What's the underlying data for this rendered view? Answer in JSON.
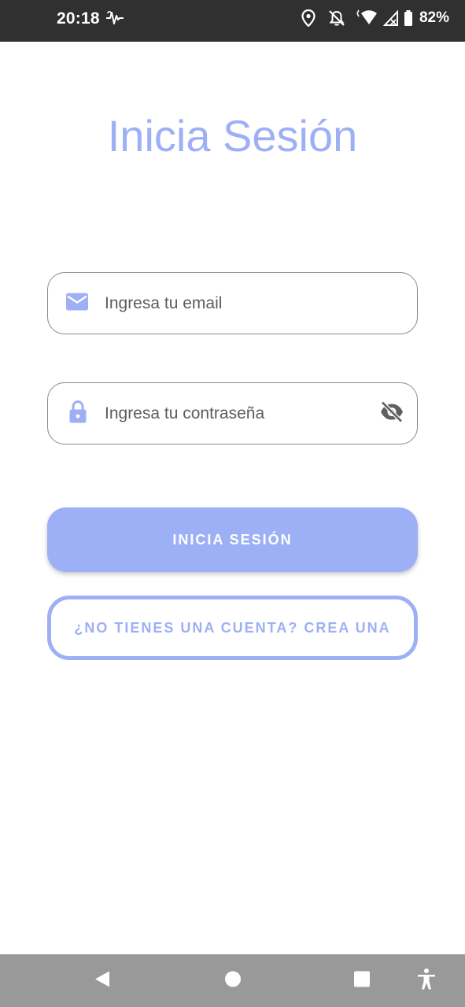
{
  "status_bar": {
    "time": "20:18",
    "battery_percent": "82%",
    "icons": [
      "pulse-icon",
      "location-icon",
      "notifications-off-icon",
      "wifi-icon",
      "signal-icon",
      "battery-icon"
    ]
  },
  "page": {
    "title": "Inicia Sesión"
  },
  "form": {
    "email": {
      "placeholder": "Ingresa tu email",
      "value": "",
      "icon": "mail-icon"
    },
    "password": {
      "placeholder": "Ingresa tu contraseña",
      "value": "",
      "icon": "lock-icon",
      "toggle_icon": "eye-off-icon"
    }
  },
  "actions": {
    "login_label": "INICIA SESIÓN",
    "signup_label": "¿NO TIENES UNA CUENTA? CREA UNA"
  },
  "nav_bar": {
    "icons": [
      "back-icon",
      "home-icon",
      "recents-icon",
      "accessibility-icon"
    ]
  },
  "colors": {
    "accent": "#9DB0F5",
    "status_bar": "#303030",
    "nav_bar": "#999999"
  }
}
